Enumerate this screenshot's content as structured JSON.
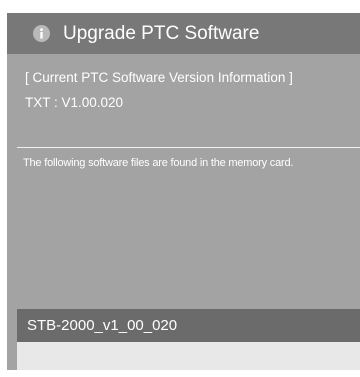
{
  "dialog": {
    "title": "Upgrade PTC Software",
    "title_icon": "info-icon"
  },
  "current_version": {
    "heading": "[ Current PTC Software Version Information ]",
    "value": "TXT : V1.00.020"
  },
  "files": {
    "message": "The following software files are found in the memory card.",
    "items": [
      {
        "name": "STB-2000_v1_00_020",
        "selected": true
      }
    ]
  },
  "colors": {
    "dialog_background": "#a3a3a3",
    "header_background": "#787878",
    "selected_item_background": "#6b6b6b",
    "empty_item_background": "#e8e8e8",
    "text": "#ffffff"
  }
}
